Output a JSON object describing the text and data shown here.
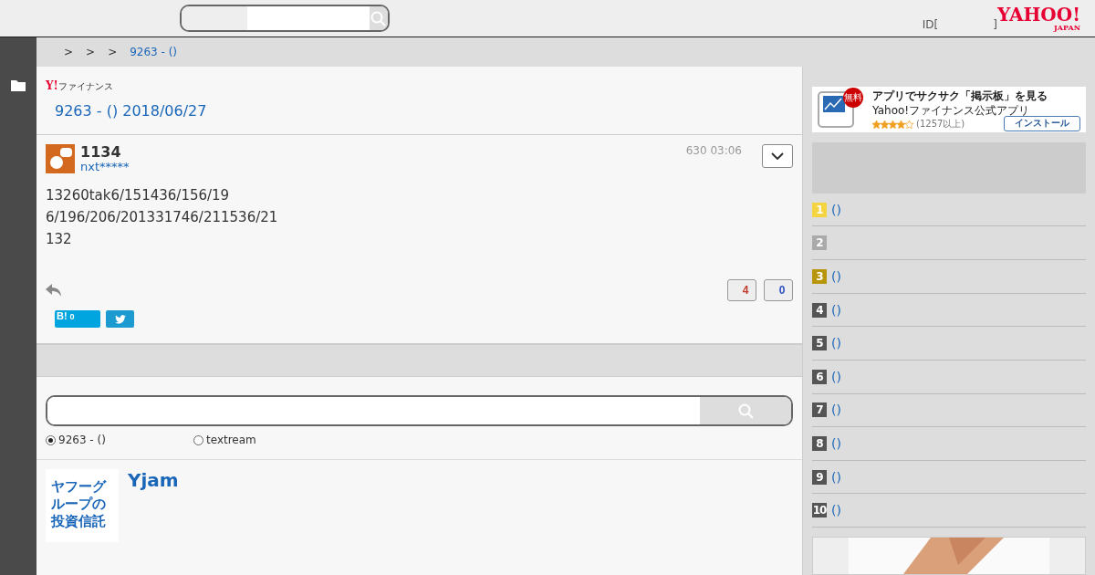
{
  "header": {
    "account": "ID[",
    "account_end": "]",
    "logo": "YAHOO!",
    "logo_sub": "JAPAN"
  },
  "breadcrumb": [
    ">",
    ">",
    ">",
    "9263 - ()"
  ],
  "brand": {
    "mark": "Y!",
    "name": "ファイナンス"
  },
  "title": "9263 - () 2018/06/27",
  "post": {
    "number": "1134",
    "user": "nxt*****",
    "time": "630 03:06",
    "lines": [
      "13260tak6/151436/156/19",
      "6/196/206/201331746/211536/21",
      "132"
    ],
    "votes": [
      {
        "count": "4",
        "color": "#c0392b"
      },
      {
        "count": "0",
        "color": "#2b4fc0"
      }
    ],
    "hatena": {
      "mark": "B!",
      "count": "0"
    }
  },
  "search": {
    "options": [
      {
        "label": "9263 - ()",
        "selected": true
      },
      {
        "label": "textream",
        "selected": false
      }
    ]
  },
  "promo": {
    "banner": "ヤフーグループの投資信託",
    "title": "Yjam"
  },
  "ad": {
    "badge": "無料",
    "title": "アプリでサクサク「掲示板」を見る",
    "subtitle": "Yahoo!ファイナンス公式アプリ",
    "stars": 4,
    "reviews": "(1257以上)",
    "button": "インストール"
  },
  "ranking": [
    {
      "rank": "1",
      "color": "#f5d442",
      "label": "()"
    },
    {
      "rank": "2",
      "color": "#aaaaaa"
    },
    {
      "rank": "3",
      "color": "#b8960c",
      "label": "()"
    },
    {
      "rank": "4",
      "color": "#555555",
      "label": "()"
    },
    {
      "rank": "5",
      "color": "#555555",
      "label": "()"
    },
    {
      "rank": "6",
      "color": "#555555",
      "label": "()"
    },
    {
      "rank": "7",
      "color": "#555555",
      "label": "()"
    },
    {
      "rank": "8",
      "color": "#555555",
      "label": "()"
    },
    {
      "rank": "9",
      "color": "#555555",
      "label": "()"
    },
    {
      "rank": "10",
      "color": "#555555",
      "label": "()"
    }
  ]
}
